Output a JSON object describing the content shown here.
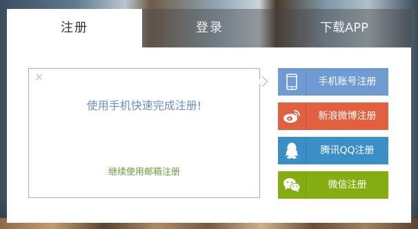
{
  "tabs": {
    "register": "注册",
    "login": "登录",
    "download_app": "下载APP"
  },
  "notice": {
    "close_glyph": "×",
    "title": "使用手机快速完成注册!",
    "email_link": "继续使用邮箱注册"
  },
  "buttons": {
    "phone": {
      "label": "手机账号注册",
      "icon": "phone-icon",
      "color": "#6f9ad3"
    },
    "weibo": {
      "label": "新浪微博注册",
      "icon": "weibo-icon",
      "color": "#e0603f"
    },
    "qq": {
      "label": "腾讯QQ注册",
      "icon": "qq-icon",
      "color": "#3a8fc6"
    },
    "wechat": {
      "label": "微信注册",
      "icon": "wechat-icon",
      "color": "#84ad12"
    }
  }
}
